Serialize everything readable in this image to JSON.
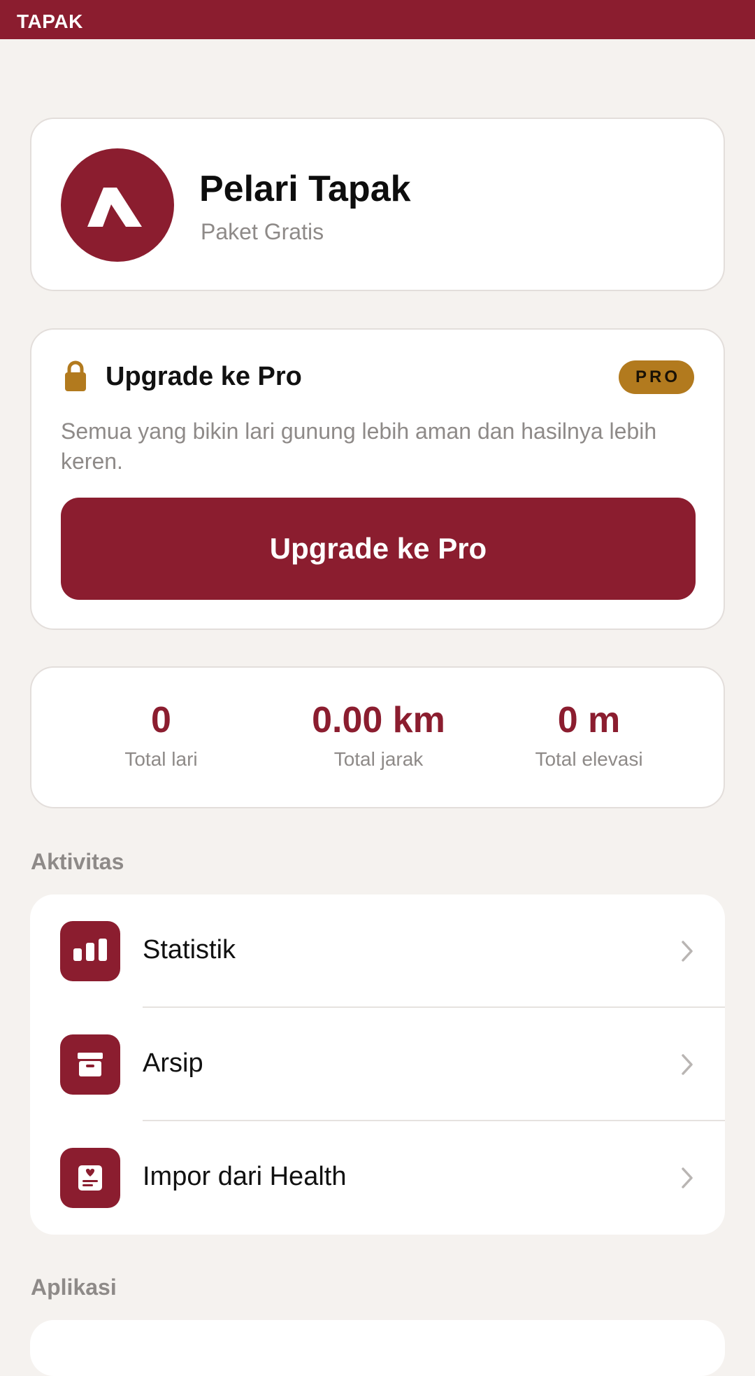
{
  "header": {
    "title": "TAPAK"
  },
  "profile": {
    "name": "Pelari Tapak",
    "plan": "Paket Gratis",
    "avatar_icon": "tapak-logo-icon"
  },
  "upgrade": {
    "title": "Upgrade ke Pro",
    "badge": "PRO",
    "description": "Semua yang bikin lari gunung lebih aman dan hasilnya lebih keren.",
    "button_label": "Upgrade ke Pro",
    "icon": "lock-icon"
  },
  "stats": [
    {
      "value": "0",
      "label": "Total lari"
    },
    {
      "value": "0.00 km",
      "label": "Total jarak"
    },
    {
      "value": "0 m",
      "label": "Total elevasi"
    }
  ],
  "sections": {
    "activity": "Aktivitas",
    "app": "Aplikasi"
  },
  "activity_items": [
    {
      "label": "Statistik",
      "icon": "bar-chart-icon"
    },
    {
      "label": "Arsip",
      "icon": "archive-box-icon"
    },
    {
      "label": "Impor dari Health",
      "icon": "health-record-icon"
    }
  ],
  "colors": {
    "brand": "#8b1d2f",
    "badge_gold": "#b27a1e",
    "background": "#f5f2ef",
    "muted_text": "#8e8a88"
  }
}
